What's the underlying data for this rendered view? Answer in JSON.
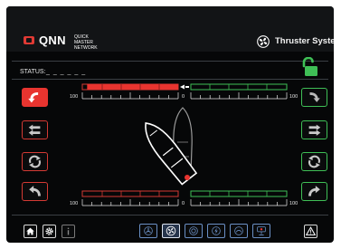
{
  "header": {
    "brand": "QNN",
    "brand_sub": "QUICK MASTER NETWORK",
    "title": "Thruster System"
  },
  "status": {
    "label": "STATUS:",
    "value": "_ _ _ _ _ _"
  },
  "gauges": {
    "top": {
      "left_max": "100",
      "center": "0",
      "right_max": "100",
      "bow_level_percent": 95,
      "direction": "left"
    },
    "bottom": {
      "left_max": "100",
      "center": "0",
      "right_max": "100"
    }
  },
  "icons": {
    "header": "fan-icon",
    "lock": "unlock-icon",
    "home": "home-icon",
    "settings": "gear-icon",
    "info": "info-icon",
    "warning": "warning-icon"
  },
  "colors": {
    "accent_red": "#e8342f",
    "accent_green": "#3fbf56",
    "selector_blue": "#6a8fc4"
  }
}
